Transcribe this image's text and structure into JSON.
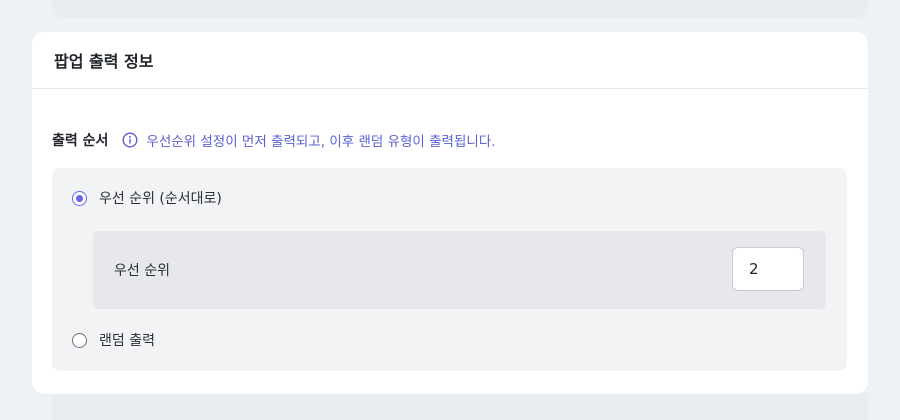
{
  "section": {
    "title": "팝업 출력 정보",
    "order_label": "출력 순서",
    "info_icon": "info-icon",
    "info_text": "우선순위 설정이 먼저 출력되고, 이후 랜덤 유형이 출력됩니다."
  },
  "options": {
    "priority": {
      "label": "우선 순위 (순서대로)",
      "checked": true
    },
    "random": {
      "label": "랜덤 출력",
      "checked": false
    }
  },
  "priority_setting": {
    "label": "우선 순위",
    "value": "2"
  },
  "colors": {
    "accent": "#6366f1",
    "info_text": "#5b5fd4",
    "background": "#eef1f5"
  }
}
